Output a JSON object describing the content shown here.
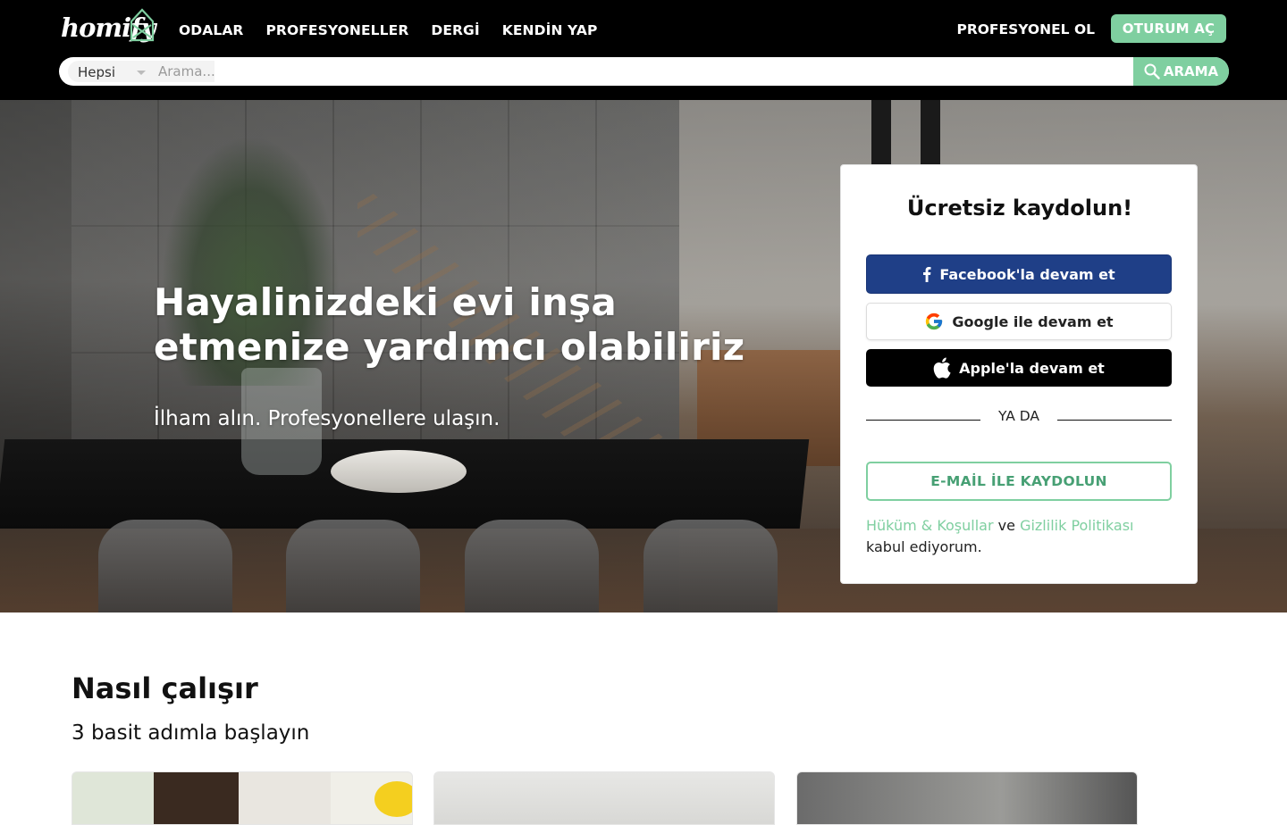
{
  "header": {
    "logo_text": "homify",
    "nav": [
      "ODALAR",
      "PROFESYONELLER",
      "DERGİ",
      "KENDİN YAP"
    ],
    "pro_link": "PROFESYONEL OL",
    "login_button": "OTURUM AÇ",
    "search": {
      "category": "Hepsi",
      "placeholder": "Arama...",
      "button": "ARAMA"
    }
  },
  "hero": {
    "title": "Hayalinizdeki evi inşa etmenize yardımcı olabiliriz",
    "subtitle": "İlham alın. Profesyonellere ulaşın."
  },
  "signup": {
    "title": "Ücretsiz kaydolun!",
    "facebook": "Facebook'la devam et",
    "google": "Google ile devam et",
    "apple": "Apple'la devam et",
    "or": "YA DA",
    "email": "E-MAİL İLE KAYDOLUN",
    "terms": {
      "terms_link": "Hüküm & Koşullar",
      "and": "ve",
      "privacy_link": "Gizlilik Politikası",
      "suffix": "kabul ediyorum."
    }
  },
  "how": {
    "title": "Nasıl çalışır",
    "subtitle": "3 basit adımla başlayın"
  },
  "colors": {
    "accent": "#7fcfa0",
    "facebook": "#1f3f87",
    "header_bg": "#000000"
  }
}
